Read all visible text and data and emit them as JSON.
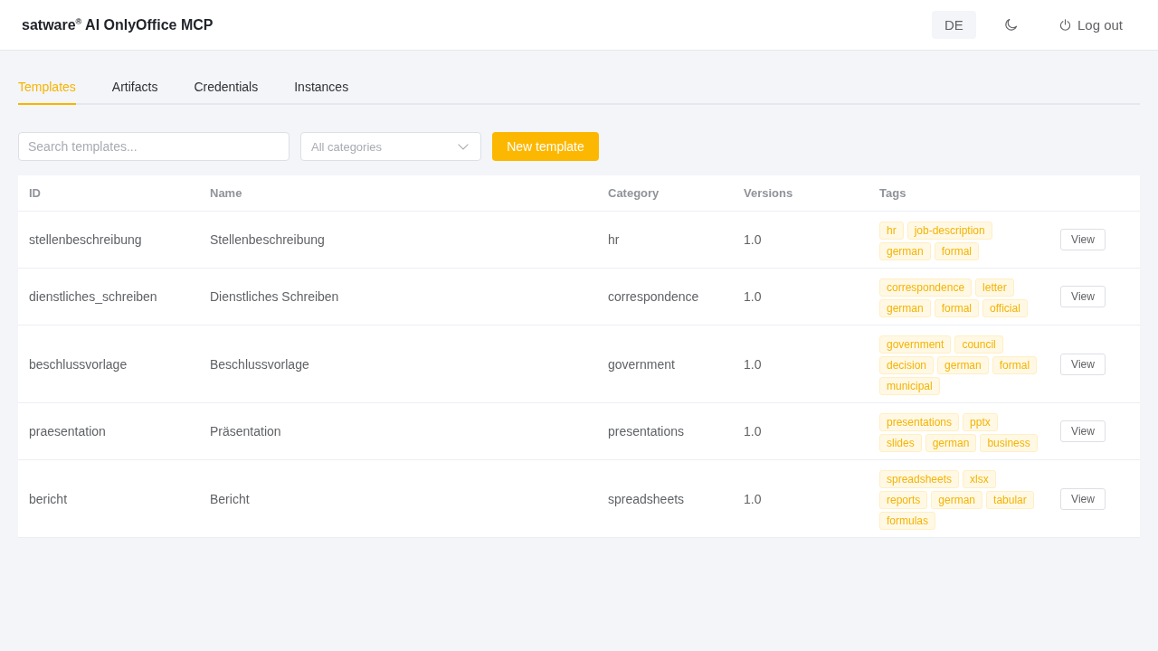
{
  "header": {
    "title": "satware$^{®}$ AI OnlyOffice MCP",
    "language": "DE",
    "logout": "Log out"
  },
  "tabs": [
    {
      "label": "Templates",
      "selected": true
    },
    {
      "label": "Artifacts",
      "selected": false
    },
    {
      "label": "Credentials",
      "selected": false
    },
    {
      "label": "Instances",
      "selected": false
    }
  ],
  "toolbar": {
    "search": {
      "placeholder": "Search templates..."
    },
    "category_select": {
      "placeholder": "All categories"
    },
    "new_button": "New template"
  },
  "table": {
    "columns": [
      "ID",
      "Name",
      "Category",
      "Versions",
      "Tags"
    ],
    "rows": [
      {
        "id": "stellenbeschreibung",
        "name": "Stellenbeschreibung",
        "category": "hr",
        "version": "1.0",
        "tags": [
          "hr",
          "job-description",
          "german",
          "formal"
        ],
        "action": "View"
      },
      {
        "id": "dienstliches_schreiben",
        "name": "Dienstliches Schreiben",
        "category": "correspondence",
        "version": "1.0",
        "tags": [
          "correspondence",
          "letter",
          "german",
          "formal",
          "official"
        ],
        "action": "View"
      },
      {
        "id": "beschlussvorlage",
        "name": "Beschlussvorlage",
        "category": "government",
        "version": "1.0",
        "tags": [
          "government",
          "council",
          "decision",
          "german",
          "formal",
          "municipal"
        ],
        "action": "View"
      },
      {
        "id": "praesentation",
        "name": "Präsentation",
        "category": "presentations",
        "version": "1.0",
        "tags": [
          "presentations",
          "pptx",
          "slides",
          "german",
          "business"
        ],
        "action": "View"
      },
      {
        "id": "bericht",
        "name": "Bericht",
        "category": "spreadsheets",
        "version": "1.0",
        "tags": [
          "spreadsheets",
          "xlsx",
          "reports",
          "german",
          "tabular",
          "formulas"
        ],
        "action": "View"
      }
    ]
  }
}
